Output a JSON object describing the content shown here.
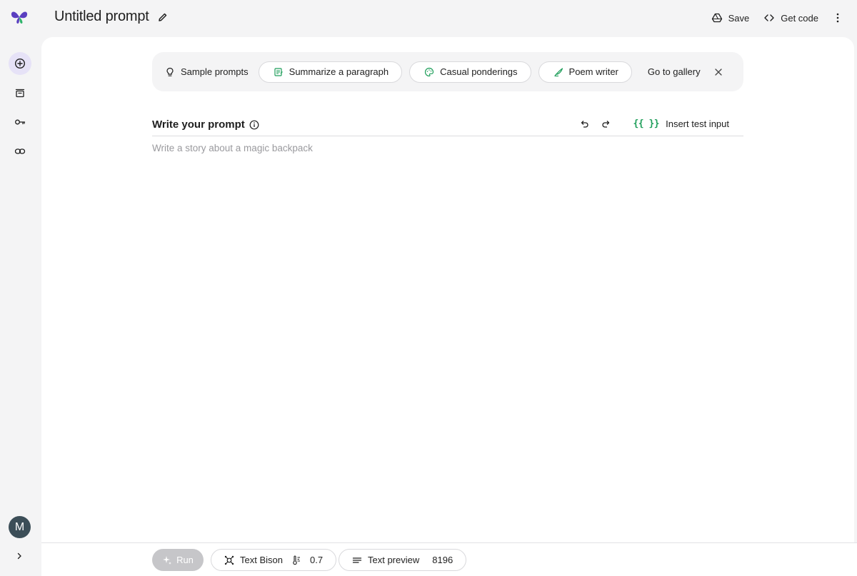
{
  "header": {
    "title": "Untitled prompt",
    "save_label": "Save",
    "get_code_label": "Get code"
  },
  "rail": {
    "avatar_initial": "M",
    "items": [
      "new-prompt-icon",
      "library-icon",
      "api-key-icon",
      "link-icon"
    ]
  },
  "samples": {
    "label": "Sample prompts",
    "chips": [
      {
        "label": "Summarize a paragraph",
        "icon": "summary-icon"
      },
      {
        "label": "Casual ponderings",
        "icon": "palette-icon"
      },
      {
        "label": "Poem writer",
        "icon": "quill-icon"
      }
    ],
    "gallery_label": "Go to gallery"
  },
  "prompt": {
    "title": "Write your prompt",
    "insert_label": "Insert test input",
    "braces": "{{ }}",
    "placeholder": "Write a story about a magic backpack"
  },
  "bottom": {
    "run_label": "Run",
    "model_label": "Text Bison",
    "temperature": "0.7",
    "preview_label": "Text preview",
    "token_limit": "8196"
  },
  "colors": {
    "accent_green": "#1e9e5a",
    "active_rail": "#e6e2f7",
    "logo_purple": "#5a3fc0",
    "logo_green": "#2fb36b"
  }
}
